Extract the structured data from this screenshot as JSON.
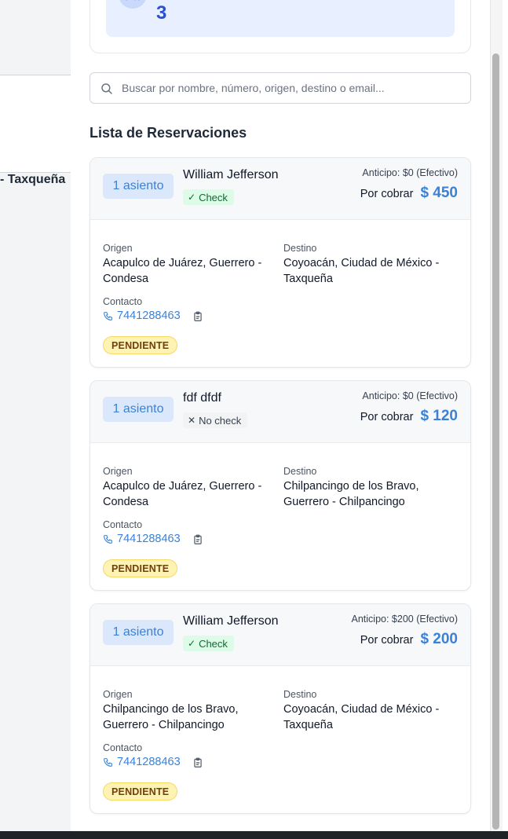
{
  "background": {
    "route_text": "- Taxqueña"
  },
  "stats": {
    "value": "3"
  },
  "search": {
    "placeholder": "Buscar por nombre, número, origen, destino o email..."
  },
  "list": {
    "title": "Lista de Reservaciones",
    "labels": {
      "origin": "Origen",
      "destination": "Destino",
      "contact": "Contacto",
      "to_collect": "Por cobrar"
    },
    "reservations": [
      {
        "seats": "1 asiento",
        "name": "William Jefferson",
        "check": "Check",
        "checked": true,
        "anticipo": "Anticipo: $0 (Efectivo)",
        "amount": "$ 450",
        "origin": "Acapulco de Juárez, Guerrero - Condesa",
        "destination": "Coyoacán, Ciudad de México - Taxqueña",
        "phone": "7441288463",
        "status": "PENDIENTE"
      },
      {
        "seats": "1 asiento",
        "name": "fdf dfdf",
        "check": "No check",
        "checked": false,
        "anticipo": "Anticipo: $0 (Efectivo)",
        "amount": "$ 120",
        "origin": "Acapulco de Juárez, Guerrero - Condesa",
        "destination": "Chilpancingo de los Bravo, Guerrero - Chilpancingo",
        "phone": "7441288463",
        "status": "PENDIENTE"
      },
      {
        "seats": "1 asiento",
        "name": "William Jefferson",
        "check": "Check",
        "checked": true,
        "anticipo": "Anticipo: $200 (Efectivo)",
        "amount": "$ 200",
        "origin": "Chilpancingo de los Bravo, Guerrero - Chilpancingo",
        "destination": "Coyoacán, Ciudad de México - Taxqueña",
        "phone": "7441288463",
        "status": "PENDIENTE"
      }
    ]
  },
  "colors": {
    "accent": "#3b82d6",
    "pending_bg": "#fef3b3",
    "check_bg": "#dcfce7",
    "stats_bg": "#e8efff"
  },
  "icons": [
    "users-icon",
    "search-icon",
    "check-icon",
    "x-icon",
    "phone-icon",
    "clipboard-icon"
  ]
}
